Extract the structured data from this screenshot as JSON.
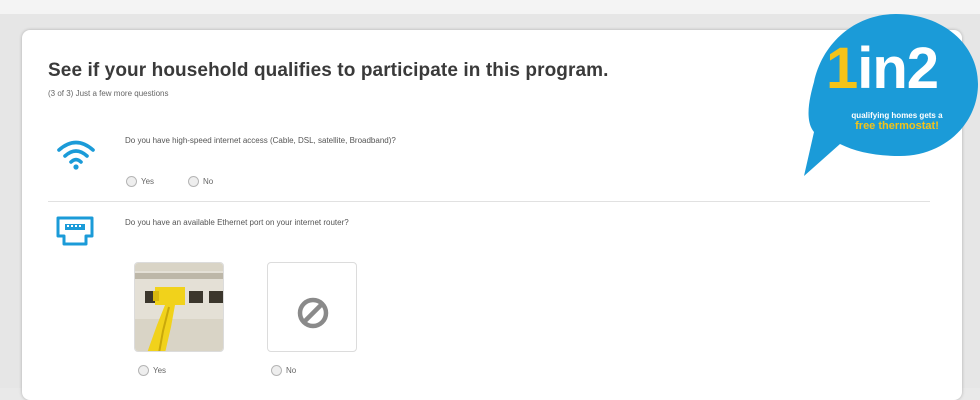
{
  "form": {
    "title": "See if your household qualifies to participate in this program.",
    "progress": "(3 of 3) Just a few more questions"
  },
  "questions": [
    {
      "icon": "wifi-icon",
      "text": "Do you have high-speed internet access (Cable, DSL, satellite, Broadband)?",
      "options": [
        "Yes",
        "No"
      ]
    },
    {
      "icon": "ethernet-port-icon",
      "text": "Do you have an available Ethernet port on your internet router?",
      "options": [
        "Yes",
        "No"
      ]
    }
  ],
  "promo": {
    "one": "1",
    "rest": "in2",
    "line1": "qualifying homes gets a",
    "line2": "free thermostat!"
  },
  "colors": {
    "accent_blue": "#1b9bd8",
    "accent_yellow": "#f5c318",
    "title_text": "#3a3a3a"
  }
}
